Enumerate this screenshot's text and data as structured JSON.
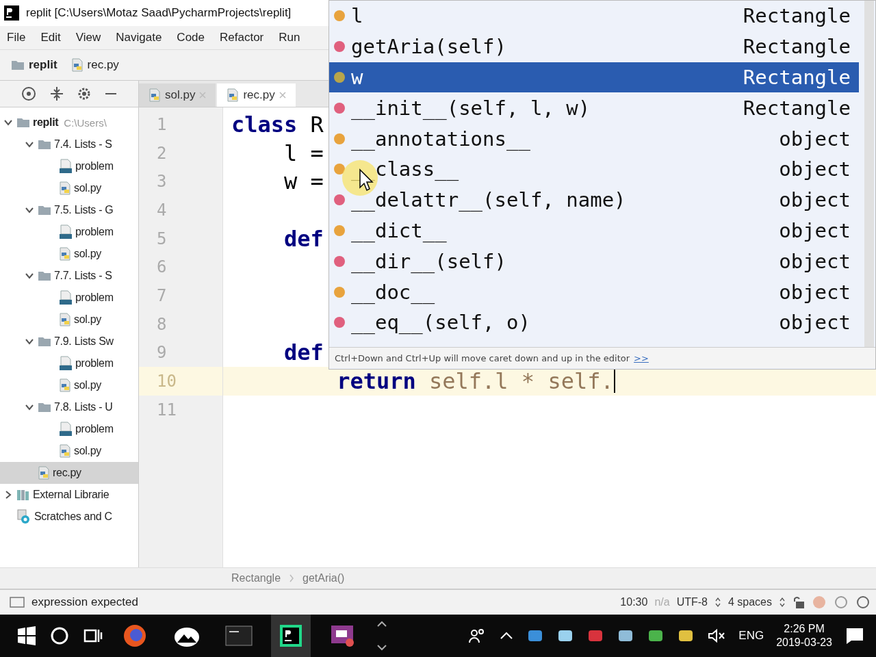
{
  "window": {
    "title": "replit [C:\\Users\\Motaz Saad\\PycharmProjects\\replit]"
  },
  "menu": [
    "File",
    "Edit",
    "View",
    "Navigate",
    "Code",
    "Refactor",
    "Run"
  ],
  "nav_bar": [
    {
      "label": "replit",
      "kind": "folder"
    },
    {
      "label": "rec.py",
      "kind": "python-file"
    }
  ],
  "tabs": [
    {
      "label": "sol.py",
      "selected": false
    },
    {
      "label": "rec.py",
      "selected": true
    }
  ],
  "project_tree": [
    {
      "label": "replit",
      "path": "C:\\Users\\",
      "kind": "folder",
      "expanded": true,
      "selected": false,
      "children": [
        {
          "label": "7.4. Lists - S",
          "kind": "folder",
          "expanded": true,
          "selected": false,
          "children": [
            {
              "label": "problem",
              "kind": "text-file",
              "selected": false
            },
            {
              "label": "sol.py",
              "kind": "python-file",
              "selected": false
            }
          ]
        },
        {
          "label": "7.5. Lists - G",
          "kind": "folder",
          "expanded": true,
          "selected": false,
          "children": [
            {
              "label": "problem",
              "kind": "text-file",
              "selected": false
            },
            {
              "label": "sol.py",
              "kind": "python-file",
              "selected": false
            }
          ]
        },
        {
          "label": "7.7. Lists - S",
          "kind": "folder",
          "expanded": true,
          "selected": false,
          "children": [
            {
              "label": "problem",
              "kind": "text-file",
              "selected": false
            },
            {
              "label": "sol.py",
              "kind": "python-file",
              "selected": false
            }
          ]
        },
        {
          "label": "7.9. Lists Sw",
          "kind": "folder",
          "expanded": true,
          "selected": false,
          "children": [
            {
              "label": "problem",
              "kind": "text-file",
              "selected": false
            },
            {
              "label": "sol.py",
              "kind": "python-file",
              "selected": false
            }
          ]
        },
        {
          "label": "7.8. Lists - U",
          "kind": "folder",
          "expanded": true,
          "selected": false,
          "children": [
            {
              "label": "problem",
              "kind": "text-file",
              "selected": false
            },
            {
              "label": "sol.py",
              "kind": "python-file",
              "selected": false
            }
          ]
        },
        {
          "label": "rec.py",
          "kind": "python-file",
          "selected": true
        }
      ]
    },
    {
      "label": "External Librarie",
      "kind": "library",
      "expanded": false,
      "selected": false
    },
    {
      "label": "Scratches and C",
      "kind": "scratches",
      "selected": false
    }
  ],
  "editor": {
    "lines": [
      {
        "number": "1",
        "current": false,
        "tokens": [
          {
            "text": "class",
            "kind": "keyword"
          },
          {
            "text": " R",
            "kind": "name"
          }
        ]
      },
      {
        "number": "2",
        "current": false,
        "tokens": [
          {
            "text": "    l =",
            "kind": "name"
          }
        ]
      },
      {
        "number": "3",
        "current": false,
        "tokens": [
          {
            "text": "    w =",
            "kind": "name"
          }
        ]
      },
      {
        "number": "4",
        "current": false
      },
      {
        "number": "5",
        "current": false,
        "tokens": [
          {
            "text": "    def",
            "kind": "keyword"
          }
        ]
      },
      {
        "number": "6",
        "current": false
      },
      {
        "number": "7",
        "current": false
      },
      {
        "number": "8",
        "current": false
      },
      {
        "number": "9",
        "current": false,
        "tokens": [
          {
            "text": "    def",
            "kind": "keyword"
          }
        ]
      },
      {
        "number": "10",
        "current": true,
        "tokens": [
          {
            "text": "        return",
            "kind": "keyword"
          },
          {
            "text": " self.l * self.",
            "kind": "self"
          }
        ]
      },
      {
        "number": "11",
        "current": false
      }
    ]
  },
  "completion": {
    "items": [
      {
        "name": "l",
        "type": "Rectangle",
        "kind": "field",
        "selected": false
      },
      {
        "name": "getAria(self)",
        "type": "Rectangle",
        "kind": "method",
        "selected": false
      },
      {
        "name": "w",
        "type": "Rectangle",
        "kind": "variable",
        "selected": true
      },
      {
        "name": "__init__(self, l, w)",
        "type": "Rectangle",
        "kind": "method",
        "selected": false
      },
      {
        "name": "__annotations__",
        "type": "object",
        "kind": "field",
        "selected": false
      },
      {
        "name": "__class__",
        "type": "object",
        "kind": "field",
        "selected": false
      },
      {
        "name": "__delattr__(self, name)",
        "type": "object",
        "kind": "method",
        "selected": false
      },
      {
        "name": "__dict__",
        "type": "object",
        "kind": "field",
        "selected": false
      },
      {
        "name": "__dir__(self)",
        "type": "object",
        "kind": "method",
        "selected": false
      },
      {
        "name": "__doc__",
        "type": "object",
        "kind": "field",
        "selected": false
      },
      {
        "name": "__eq__(self, o)",
        "type": "object",
        "kind": "method",
        "selected": false
      }
    ],
    "hint": "Ctrl+Down and Ctrl+Up will move caret down and up in the editor",
    "hint_link": ">>"
  },
  "breadcrumbs": [
    "Rectangle",
    "getAria()"
  ],
  "status_bar": {
    "message": "expression expected",
    "position": "10:30",
    "line_separator": "n/a",
    "encoding": "UTF-8",
    "indent": "4 spaces"
  },
  "taskbar": {
    "apps": [
      {
        "kind": "firefox",
        "active": false
      },
      {
        "kind": "photos",
        "active": false
      },
      {
        "kind": "terminal",
        "active": false
      },
      {
        "kind": "pycharm",
        "active": true
      },
      {
        "kind": "presenter",
        "active": false
      }
    ],
    "language": "ENG",
    "time": "2:26 PM",
    "date": "2019-03-23"
  }
}
